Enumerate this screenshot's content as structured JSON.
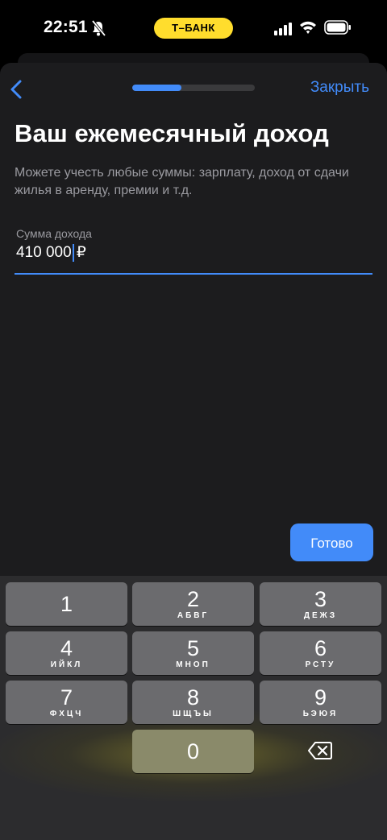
{
  "status_bar": {
    "time": "22:51",
    "bank_label": "Т–БАНК",
    "icons": [
      "bell-muted-icon",
      "signal-icon",
      "wifi-icon",
      "battery-icon"
    ]
  },
  "header": {
    "back_icon": "chevron-left-icon",
    "progress": 0.4,
    "close_label": "Закрыть"
  },
  "content": {
    "title": "Ваш ежемесячный доход",
    "subtitle": "Можете учесть любые суммы: зарплату, доход от сдачи жилья в аренду, премии и т.д.",
    "field": {
      "label": "Сумма дохода",
      "value": "410 000",
      "currency": "₽"
    },
    "done_label": "Готово"
  },
  "keyboard": {
    "keys": [
      {
        "num": "1",
        "letters": ""
      },
      {
        "num": "2",
        "letters": "АБВГ"
      },
      {
        "num": "3",
        "letters": "ДЕЖЗ"
      },
      {
        "num": "4",
        "letters": "ИЙКЛ"
      },
      {
        "num": "5",
        "letters": "МНОП"
      },
      {
        "num": "6",
        "letters": "РСТУ"
      },
      {
        "num": "7",
        "letters": "ФХЦЧ"
      },
      {
        "num": "8",
        "letters": "ШЩЪЫ"
      },
      {
        "num": "9",
        "letters": "ЬЭЮЯ"
      },
      {
        "num": "0",
        "letters": ""
      }
    ],
    "delete_icon": "backspace-icon"
  },
  "colors": {
    "accent": "#428bf9",
    "brand_yellow": "#ffdd2d",
    "sheet_bg": "#1c1c1e",
    "key_bg": "#6b6b6e"
  }
}
